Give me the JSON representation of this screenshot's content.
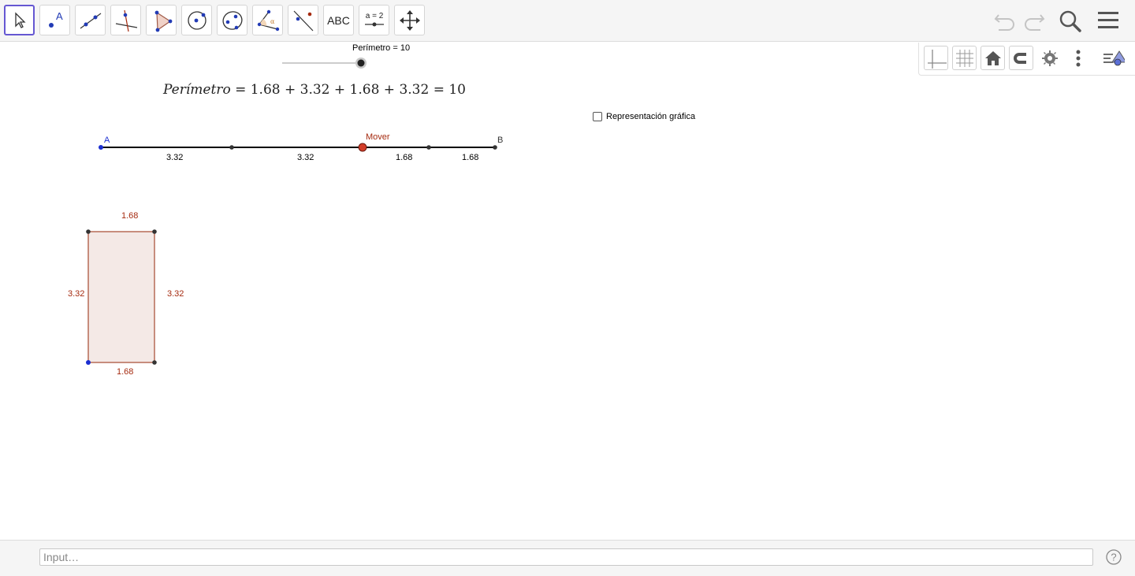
{
  "toolbar": {
    "tools": [
      {
        "name": "move-tool",
        "label": ""
      },
      {
        "name": "point-tool",
        "label": "A"
      },
      {
        "name": "line-tool",
        "label": ""
      },
      {
        "name": "perpendicular-line-tool",
        "label": ""
      },
      {
        "name": "polygon-tool",
        "label": ""
      },
      {
        "name": "circle-tool",
        "label": ""
      },
      {
        "name": "conic-tool",
        "label": ""
      },
      {
        "name": "angle-tool",
        "label": "α"
      },
      {
        "name": "reflect-tool",
        "label": ""
      },
      {
        "name": "text-tool",
        "label": "ABC"
      },
      {
        "name": "slider-tool",
        "label": "a = 2"
      },
      {
        "name": "move-graphics-tool",
        "label": ""
      }
    ],
    "icons": [
      "undo-icon",
      "redo-icon",
      "search-icon",
      "menu-icon"
    ]
  },
  "slider": {
    "label": "Perímetro = 10",
    "value": 10,
    "fraction": 1.0
  },
  "formula": {
    "lhs": "Perímetro",
    "rhs": " = 1.68 + 3.32 + 1.68 + 3.32 = 10"
  },
  "checkbox": {
    "label": "Representación gráfica",
    "checked": false
  },
  "segment": {
    "point_a": "A",
    "point_b": "B",
    "mover": "Mover",
    "labels": [
      "3.32",
      "3.32",
      "1.68",
      "1.68"
    ]
  },
  "rectangle": {
    "top": "1.68",
    "bottom": "1.68",
    "left": "3.32",
    "right": "3.32",
    "width": 1.68,
    "height": 3.32
  },
  "style_bar": {
    "icons": [
      "axes-icon",
      "grid-icon",
      "home-icon",
      "magnet-icon",
      "gear-icon",
      "more-vert-icon",
      "toggle-style-bar-icon"
    ]
  },
  "input": {
    "placeholder": "Input…",
    "help": "?"
  },
  "colors": {
    "accent": "#6557d2",
    "point_blue": "#0000cc",
    "mover_red": "#d23e2a",
    "label_red": "#a52a0f",
    "polygon_fill": "#f4e9e6",
    "polygon_stroke": "#b66a57"
  }
}
